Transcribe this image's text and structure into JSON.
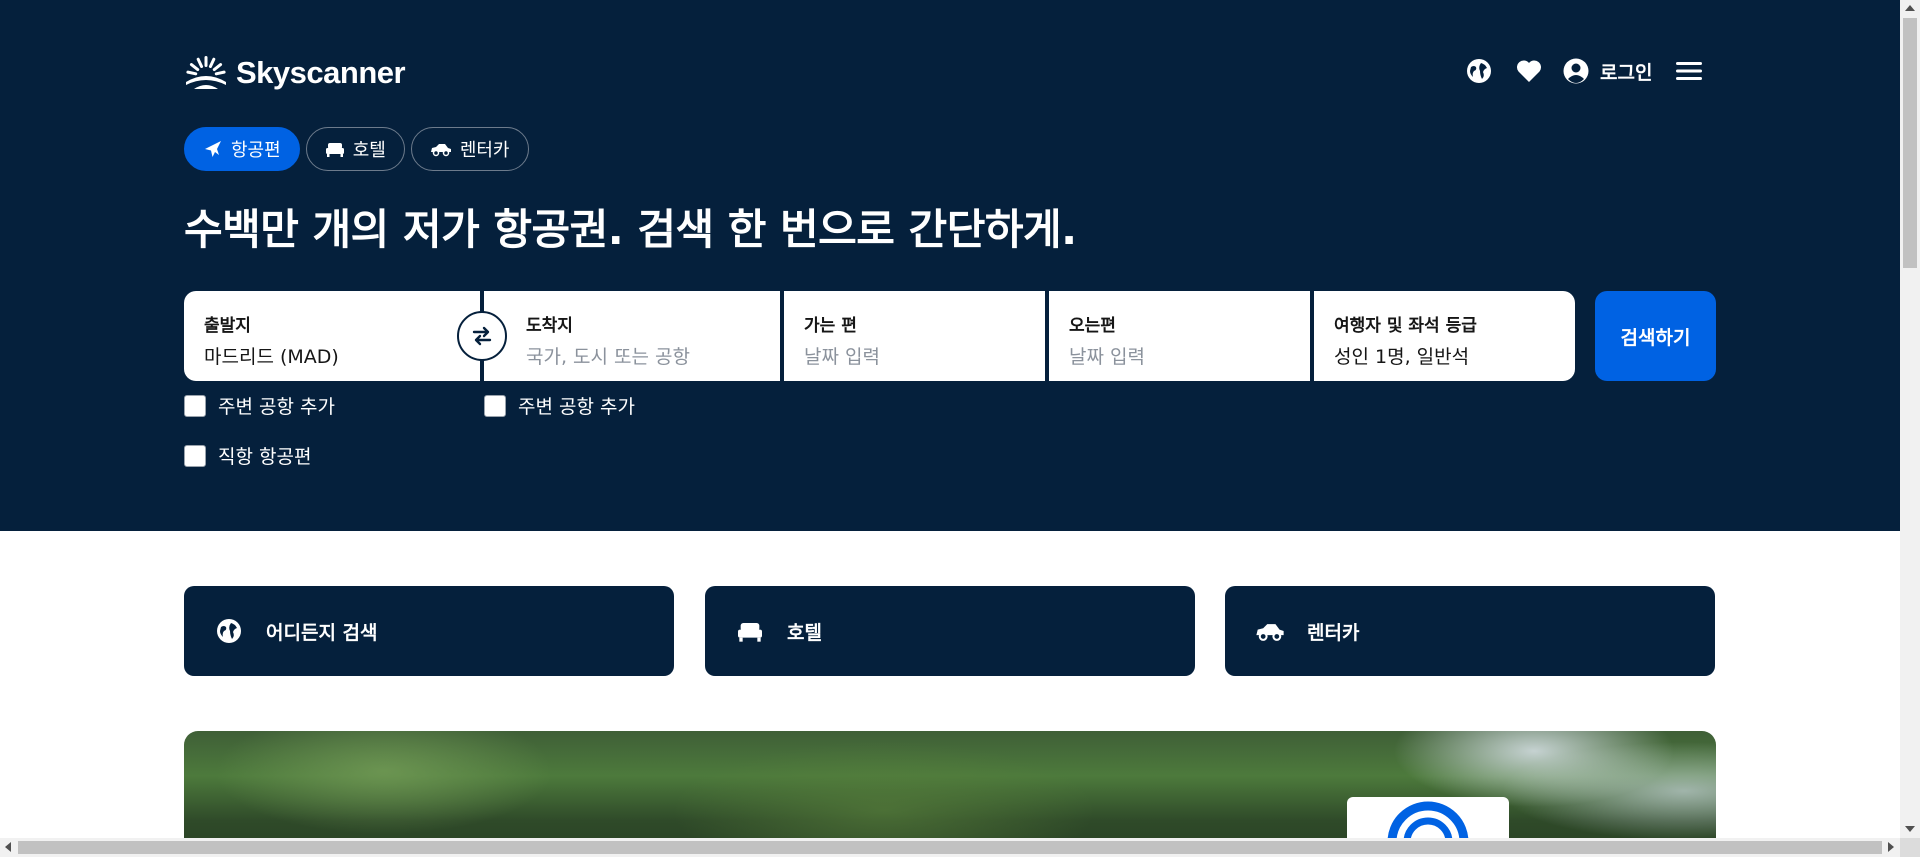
{
  "colors": {
    "hero_background": "#05203c",
    "accent_blue": "#0062e3",
    "white": "#ffffff",
    "placeholder": "#8b929c"
  },
  "header": {
    "logo_text": "Skyscanner",
    "login_label": "로그인",
    "icons": [
      "globe-icon",
      "heart-icon",
      "account-icon",
      "menu-icon"
    ]
  },
  "tabs": [
    {
      "label": "항공편",
      "icon": "plane-icon",
      "active": true
    },
    {
      "label": "호텔",
      "icon": "bed-icon",
      "active": false
    },
    {
      "label": "렌터카",
      "icon": "car-icon",
      "active": false
    }
  ],
  "headline": "수백만 개의 저가 항공권. 검색 한 번으로 간단하게.",
  "search": {
    "origin": {
      "label": "출발지",
      "value": "마드리드 (MAD)"
    },
    "destination": {
      "label": "도착지",
      "placeholder": "국가, 도시 또는 공항"
    },
    "depart": {
      "label": "가는 편",
      "placeholder": "날짜 입력"
    },
    "return": {
      "label": "오는편",
      "placeholder": "날짜 입력"
    },
    "travellers": {
      "label": "여행자 및 좌석 등급",
      "value": "성인 1명, 일반석"
    },
    "search_button": "검색하기"
  },
  "checkboxes": {
    "origin_nearby": "주변 공항 추가",
    "dest_nearby": "주변 공항 추가",
    "direct_only": "직항 항공편"
  },
  "quick_links": [
    {
      "label": "어디든지 검색",
      "icon": "globe-icon"
    },
    {
      "label": "호텔",
      "icon": "bed-icon"
    },
    {
      "label": "렌터카",
      "icon": "car-icon"
    }
  ]
}
